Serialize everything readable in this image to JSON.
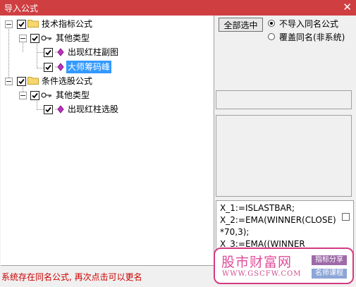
{
  "window": {
    "title": "导入公式",
    "close_glyph": "✕"
  },
  "tree": {
    "root1_label": "技术指标公式",
    "root1_child_label": "其他类型",
    "item1_label": "出现红柱副图",
    "item2_label": "大师筹码峰",
    "root2_label": "条件选股公式",
    "root2_child_label": "其他类型",
    "item3_label": "出现红柱选股"
  },
  "controls": {
    "select_all_label": "全部选中",
    "option1_label": "不导入同名公式",
    "option2_label": "覆盖同名(非系统)",
    "selected_option": "option1"
  },
  "code_lines": [
    "X_1:=ISLASTBAR;",
    "X_2:=EMA(WINNER(CLOSE)",
    "*70,3);",
    "X_3:=EMA((WINNER"
  ],
  "status_text": "系统存在同名公式, 再次点击可以更名",
  "watermark": {
    "brand": "股市财富网",
    "url": "WWW.GSCFW.COM",
    "tag1": "指标分享",
    "tag2": "名师课程"
  },
  "colors": {
    "titlebar": "#cf3f42",
    "selection": "#3399ff",
    "status": "#cc0000",
    "watermark": "#e04d9a"
  }
}
